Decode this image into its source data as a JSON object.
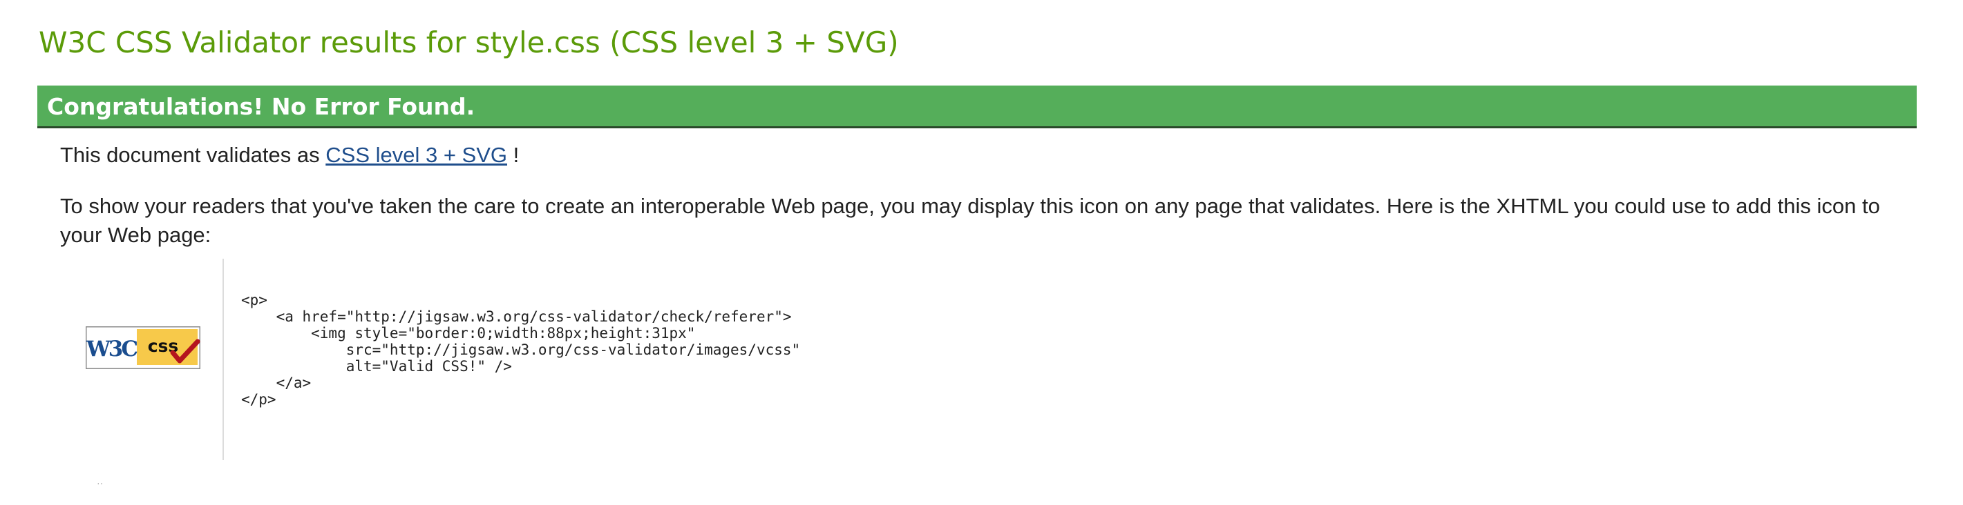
{
  "page_title": "W3C CSS Validator results for style.css (CSS level 3 + SVG)",
  "banner": {
    "text": "Congratulations! No Error Found.",
    "color": "#55ae5a"
  },
  "validation": {
    "prefix": "This document validates as ",
    "profile_link": "CSS level 3 + SVG",
    "suffix": " !"
  },
  "icon_note": "To show your readers that you've taken the care to create an interoperable Web page, you may display this icon on any page that validates. Here is the XHTML you could use to add this icon to your Web page:",
  "badge": {
    "icon": "w3c-css-valid-icon",
    "w3c_text": "W3C",
    "css_text": "css"
  },
  "code_snippet": "<p>\n    <a href=\"http://jigsaw.w3.org/css-validator/check/referer\">\n        <img style=\"border:0;width:88px;height:31px\"\n            src=\"http://jigsaw.w3.org/css-validator/images/vcss\"\n            alt=\"Valid CSS!\" />\n    </a>\n</p>",
  "colors": {
    "title": "#5b9b09",
    "link": "#1f4e8c",
    "badge_yellow": "#f7c94a",
    "badge_blue": "#1a4d8f",
    "check_red": "#b4141e"
  }
}
